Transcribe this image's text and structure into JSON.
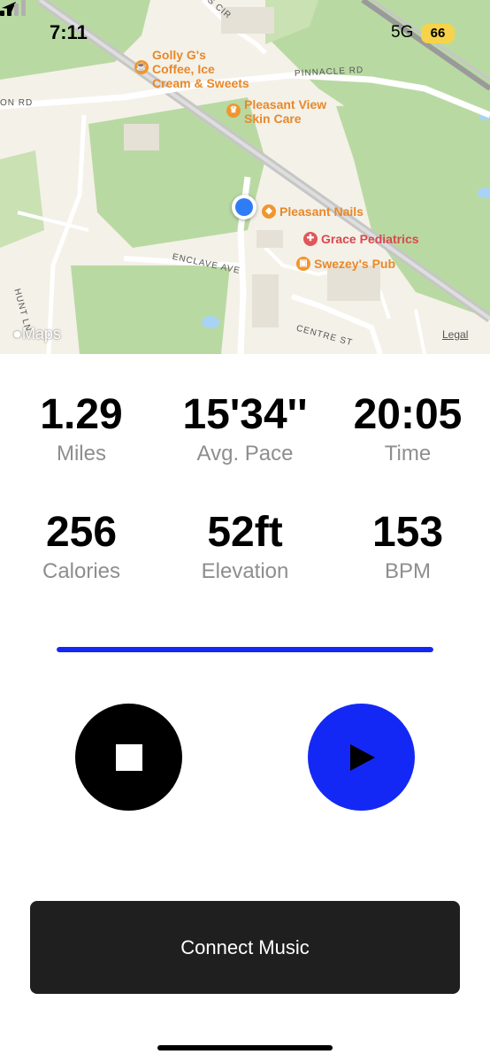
{
  "status_bar": {
    "time": "7:11",
    "network": "5G",
    "battery": "66"
  },
  "map": {
    "pois": [
      {
        "name": "Golly G's\nCoffee, Ice\nCream & Sweets",
        "icon": "coffee-icon",
        "color": "#f0962e"
      },
      {
        "name": "Pleasant View\nSkin Care",
        "icon": "crown-icon",
        "color": "#f0962e"
      },
      {
        "name": "Pleasant Nails",
        "icon": "nail-icon",
        "color": "#f0962e"
      },
      {
        "name": "Grace Pediatrics",
        "icon": "stethoscope-icon",
        "color": "#e0575a"
      },
      {
        "name": "Swezey's Pub",
        "icon": "mug-icon",
        "color": "#f0962e"
      }
    ],
    "roads": [
      "PINNACLE RD",
      "ON RD",
      "ENCLAVE AVE",
      "HUNT LN",
      "CENTRE ST",
      "S CIR"
    ],
    "brand": "Maps",
    "legal": "Legal"
  },
  "stats": [
    {
      "value": "1.29",
      "label": "Miles"
    },
    {
      "value": "15'34''",
      "label": "Avg. Pace"
    },
    {
      "value": "20:05",
      "label": "Time"
    },
    {
      "value": "256",
      "label": "Calories"
    },
    {
      "value": "52ft",
      "label": "Elevation"
    },
    {
      "value": "153",
      "label": "BPM"
    }
  ],
  "progress_fraction": 1.0,
  "colors": {
    "accent": "#1428f5",
    "stop": "#000000",
    "connect_bg": "#1f1f1f"
  },
  "actions": {
    "connect_music": "Connect Music"
  }
}
